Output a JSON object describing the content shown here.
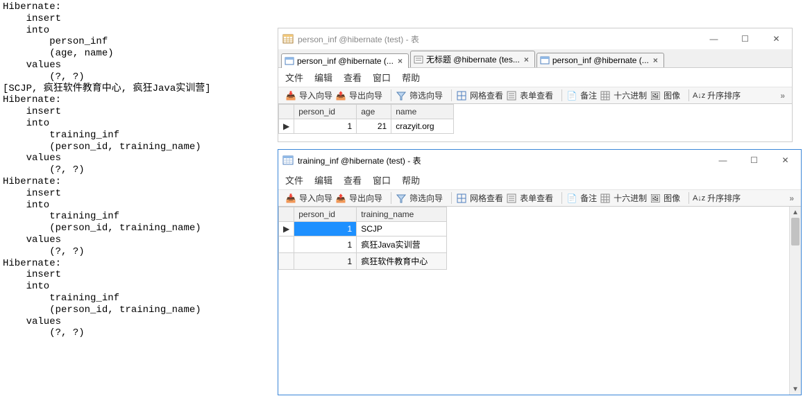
{
  "sql_log": "Hibernate: \n    insert \n    into\n        person_inf\n        (age, name) \n    values\n        (?, ?)\n[SCJP, 疯狂软件教育中心, 疯狂Java实训营]\nHibernate: \n    insert \n    into\n        training_inf\n        (person_id, training_name) \n    values\n        (?, ?)\nHibernate: \n    insert \n    into\n        training_inf\n        (person_id, training_name) \n    values\n        (?, ?)\nHibernate: \n    insert \n    into\n        training_inf\n        (person_id, training_name) \n    values\n        (?, ?)",
  "win1": {
    "title": "person_inf @hibernate (test) - 表",
    "tabs": [
      {
        "label": "person_inf @hibernate (...",
        "active": true
      },
      {
        "label": "无标题 @hibernate (tes...",
        "active": false
      },
      {
        "label": "person_inf @hibernate (...",
        "active": false
      }
    ],
    "menu": [
      "文件",
      "编辑",
      "查看",
      "窗口",
      "帮助"
    ],
    "toolbar": {
      "items": [
        "导入向导",
        "导出向导",
        "筛选向导",
        "网格查看",
        "表单查看",
        "备注",
        "十六进制",
        "图像",
        "升序排序"
      ],
      "chevron": "»"
    },
    "table": {
      "columns": [
        "person_id",
        "age",
        "name"
      ],
      "rows": [
        {
          "person_id": "1",
          "age": "21",
          "name": "crazyit.org"
        }
      ]
    }
  },
  "win2": {
    "title": "training_inf @hibernate (test) - 表",
    "menu": [
      "文件",
      "编辑",
      "查看",
      "窗口",
      "帮助"
    ],
    "toolbar": {
      "items": [
        "导入向导",
        "导出向导",
        "筛选向导",
        "网格查看",
        "表单查看",
        "备注",
        "十六进制",
        "图像",
        "升序排序"
      ],
      "chevron": "»"
    },
    "table": {
      "columns": [
        "person_id",
        "training_name"
      ],
      "rows": [
        {
          "person_id": "1",
          "training_name": "SCJP",
          "selected": true
        },
        {
          "person_id": "1",
          "training_name": "疯狂Java实训营"
        },
        {
          "person_id": "1",
          "training_name": "疯狂软件教育中心"
        }
      ]
    }
  },
  "winctrl": {
    "min": "—",
    "max": "☐",
    "close": "✕"
  }
}
